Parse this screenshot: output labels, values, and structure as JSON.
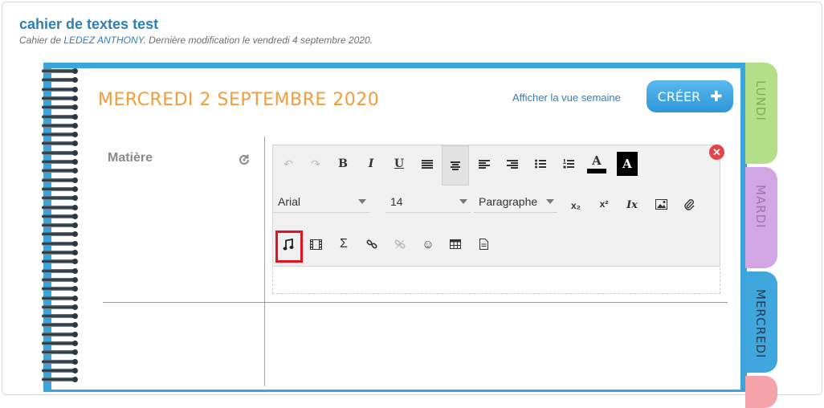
{
  "header": {
    "title": "cahier de textes test",
    "subtitle_prefix": "Cahier de ",
    "author": "LEDEZ ANTHONY",
    "subtitle_suffix": ". Dernière modification le vendredi 4 septembre 2020."
  },
  "day": {
    "title": "MERCREDI 2 SEPTEMBRE 2020",
    "week_link": "Afficher la vue semaine",
    "create_label": "CRÉER",
    "create_icon": "plus-icon"
  },
  "form": {
    "matiere_label": "Matière",
    "refresh_icon": "refresh-icon"
  },
  "editor": {
    "font_family": "Arial",
    "font_size": "14",
    "block_format": "Paragraphe",
    "bold": "B",
    "italic": "I",
    "underline": "U",
    "text_color_glyph": "A",
    "bg_color_glyph": "A",
    "subscript": "x₂",
    "superscript": "x²",
    "clear_format": "Ix",
    "selected_tool": "music-icon"
  },
  "tabs": [
    {
      "label": "LUNDI",
      "color": "#b5de8a",
      "text_color": "#7fae55"
    },
    {
      "label": "MARDI",
      "color": "#d2a5e4",
      "text_color": "#9b74ac"
    },
    {
      "label": "MERCREDI",
      "color": "#3fa6de",
      "text_color": "#1f3d55"
    },
    {
      "label": "",
      "color": "#f4a3aa",
      "text_color": "#b05a62"
    }
  ],
  "colors": {
    "accent_blue": "#2f7fb5",
    "day_title": "#f39c3a",
    "notebook_blue": "#3aa4dd",
    "highlight_red": "#e0141e"
  }
}
